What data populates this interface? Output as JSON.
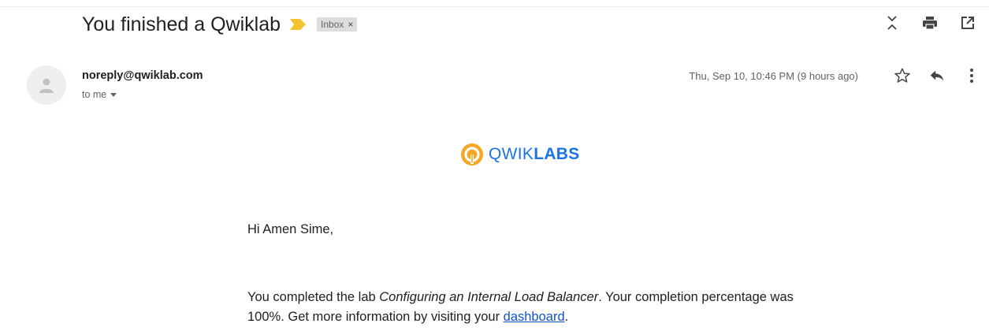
{
  "email": {
    "subject": "You finished a Qwiklab",
    "label": "Inbox",
    "label_remove": "×",
    "sender": "noreply@qwiklab.com",
    "recipient": "to me",
    "date": "Thu, Sep 10, 10:46 PM (9 hours ago)"
  },
  "logo": {
    "text_light": "QWIK",
    "text_bold": "LABS"
  },
  "body": {
    "greeting": "Hi Amen Sime,",
    "p1_before": "You completed the lab ",
    "p1_lab": "Configuring an Internal Load Balancer",
    "p1_after": ". Your completion percentage was 100%. Get more information by visiting your ",
    "p1_link": "dashboard",
    "p1_end": "."
  },
  "colors": {
    "accent_blue": "#1a73e8",
    "link": "#1155cc",
    "logo_orange": "#f5a623",
    "importance_yellow": "#f4c430"
  },
  "icons": {
    "importance": "importance-marker-icon",
    "expand_all": "expand-collapse-icon",
    "print": "print-icon",
    "open_new_window": "open-in-new-window-icon",
    "avatar": "default-avatar-icon",
    "star": "star-icon",
    "reply": "reply-icon",
    "more": "more-vert-icon"
  }
}
